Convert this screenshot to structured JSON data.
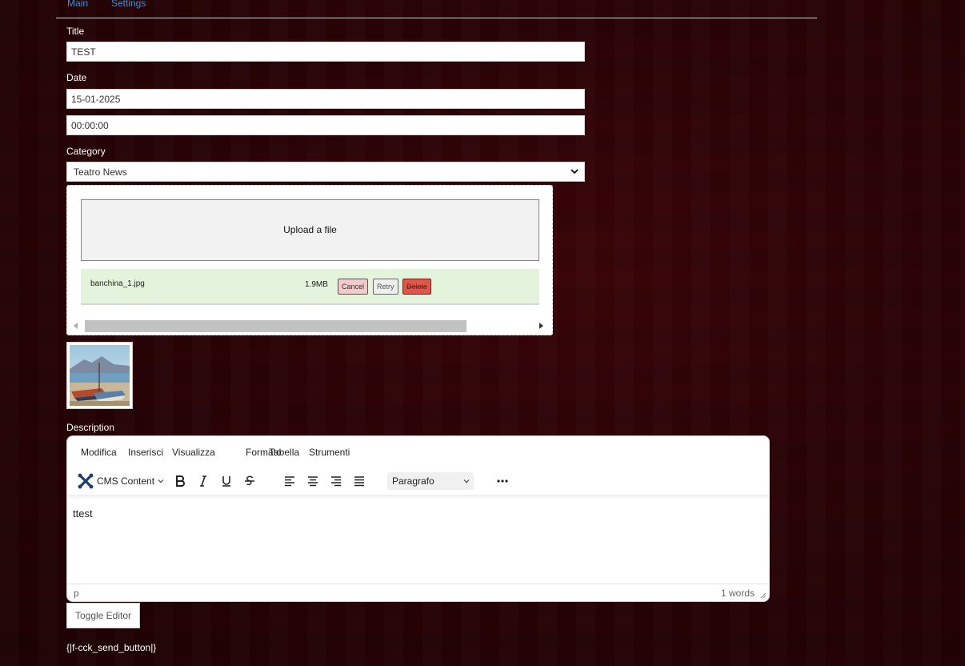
{
  "tabs": [
    {
      "label": "Main"
    },
    {
      "label": "Settings"
    }
  ],
  "form": {
    "title_label": "Title",
    "title_value": "TEST",
    "date_label": "Date",
    "date_value": "15-01-2025",
    "time_value": "00:00:00",
    "category_label": "Category",
    "category_value": "Teatro News"
  },
  "upload": {
    "dropzone_label": "Upload a file",
    "file_name": "banchina_1.jpg",
    "file_size": "1.9MB",
    "cancel_label": "Cancel",
    "retry_label": "Retry",
    "delete_label": "Delete"
  },
  "description": {
    "label": "Description",
    "menu": [
      "Modifica",
      "Inserisci",
      "Visualizza",
      "Formato",
      "Tabella",
      "Strumenti"
    ],
    "cms_content_label": "CMS Content",
    "format_select": "Paragrafo",
    "content": "ttest",
    "status_path": "p",
    "word_count": "1 words"
  },
  "toggle_editor_label": "Toggle Editor",
  "send_button_token": "{|f-cck_send_button|}",
  "colors": {
    "background": "#2a0407",
    "link": "#3d8fd0",
    "dropzone_border": "#2fa3c9",
    "file_row_bg": "#e4f3dc",
    "delete_bg": "#e0574a"
  }
}
